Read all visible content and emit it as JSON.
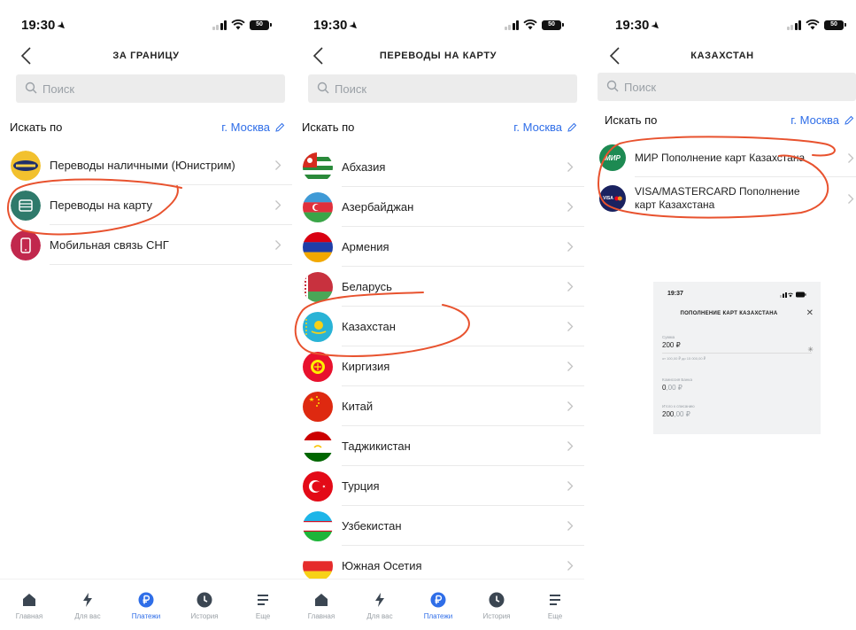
{
  "screens": [
    {
      "time": "19:30",
      "battery": "50",
      "title": "ЗА ГРАНИЦУ",
      "search_placeholder": "Поиск",
      "filter_label": "Искать по",
      "city": "г. Москва",
      "items": [
        {
          "label": "Переводы наличными (Юнистрим)",
          "icon": "unistream-icon"
        },
        {
          "label": "Переводы на карту",
          "icon": "card-icon"
        },
        {
          "label": "Мобильная связь СНГ",
          "icon": "phone-icon"
        }
      ],
      "tabs": [
        {
          "label": "Главная",
          "icon": "home-icon"
        },
        {
          "label": "Для вас",
          "icon": "lightning-icon"
        },
        {
          "label": "Платежи",
          "icon": "ruble-icon",
          "active": true
        },
        {
          "label": "История",
          "icon": "clock-icon"
        },
        {
          "label": "Еще",
          "icon": "menu-icon"
        }
      ]
    },
    {
      "time": "19:30",
      "battery": "50",
      "title": "ПЕРЕВОДЫ НА КАРТУ",
      "search_placeholder": "Поиск",
      "filter_label": "Искать по",
      "city": "г. Москва",
      "items": [
        {
          "label": "Абхазия",
          "icon": "flag-abkhazia-icon"
        },
        {
          "label": "Азербайджан",
          "icon": "flag-azerbaijan-icon"
        },
        {
          "label": "Армения",
          "icon": "flag-armenia-icon"
        },
        {
          "label": "Беларусь",
          "icon": "flag-belarus-icon"
        },
        {
          "label": "Казахстан",
          "icon": "flag-kazakhstan-icon"
        },
        {
          "label": "Киргизия",
          "icon": "flag-kyrgyzstan-icon"
        },
        {
          "label": "Китай",
          "icon": "flag-china-icon"
        },
        {
          "label": "Таджикистан",
          "icon": "flag-tajikistan-icon"
        },
        {
          "label": "Турция",
          "icon": "flag-turkey-icon"
        },
        {
          "label": "Узбекистан",
          "icon": "flag-uzbekistan-icon"
        },
        {
          "label": "Южная Осетия",
          "icon": "flag-south-ossetia-icon"
        }
      ],
      "tabs": [
        {
          "label": "Главная",
          "icon": "home-icon"
        },
        {
          "label": "Для вас",
          "icon": "lightning-icon"
        },
        {
          "label": "Платежи",
          "icon": "ruble-icon",
          "active": true
        },
        {
          "label": "История",
          "icon": "clock-icon"
        },
        {
          "label": "Еще",
          "icon": "menu-icon"
        }
      ]
    },
    {
      "time": "19:30",
      "battery": "50",
      "title": "КАЗАХСТАН",
      "search_placeholder": "Поиск",
      "filter_label": "Искать по",
      "city": "г. Москва",
      "items": [
        {
          "label": "МИР Пополнение карт Казахстана",
          "icon": "mir-icon",
          "icon_text": "МИР"
        },
        {
          "label": "VISA/MASTERCARD Пополнение карт Казахстана",
          "icon": "visa-mastercard-icon",
          "icon_text": "VISA"
        }
      ]
    }
  ],
  "mini": {
    "time": "19:37",
    "title": "ПОПОЛНЕНИЕ КАРТ КАЗАХСТАНА",
    "close": "✕",
    "amount_label": "Сумма",
    "amount_value": "200 ₽",
    "amount_hint": "от 100,00 ₽ до 15 000,00 ₽",
    "commission_label": "Комиссия Банка",
    "commission_int": "0",
    "commission_frac": ",00 ₽",
    "total_label": "Итого к списанию",
    "total_int": "200",
    "total_frac": ",00 ₽"
  }
}
